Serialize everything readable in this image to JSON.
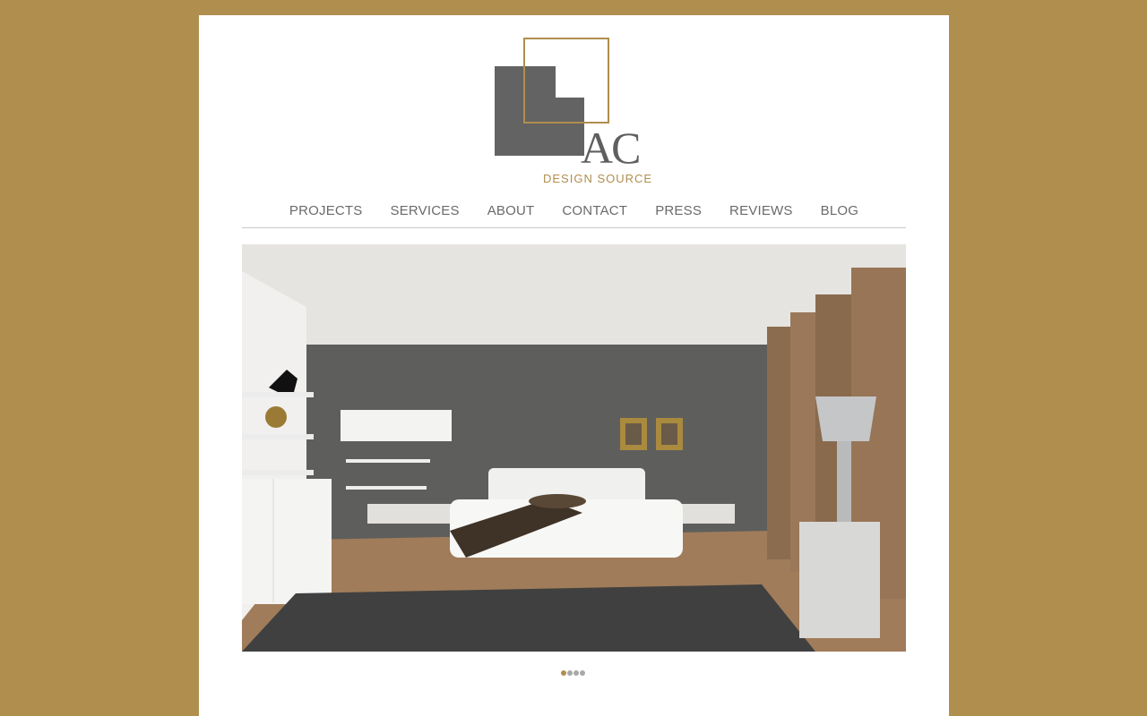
{
  "logo": {
    "mark": "AC",
    "tagline": "DESIGN SOURCE"
  },
  "nav": {
    "items": [
      {
        "label": "PROJECTS"
      },
      {
        "label": "SERVICES"
      },
      {
        "label": "ABOUT"
      },
      {
        "label": "CONTACT"
      },
      {
        "label": "PRESS"
      },
      {
        "label": "REVIEWS"
      },
      {
        "label": "BLOG"
      }
    ]
  },
  "slideshow": {
    "slide_count": 4,
    "active_slide": 1
  },
  "colors": {
    "background": "#b08e4e",
    "accent": "#b08e4e",
    "logo_gray": "#636363"
  }
}
